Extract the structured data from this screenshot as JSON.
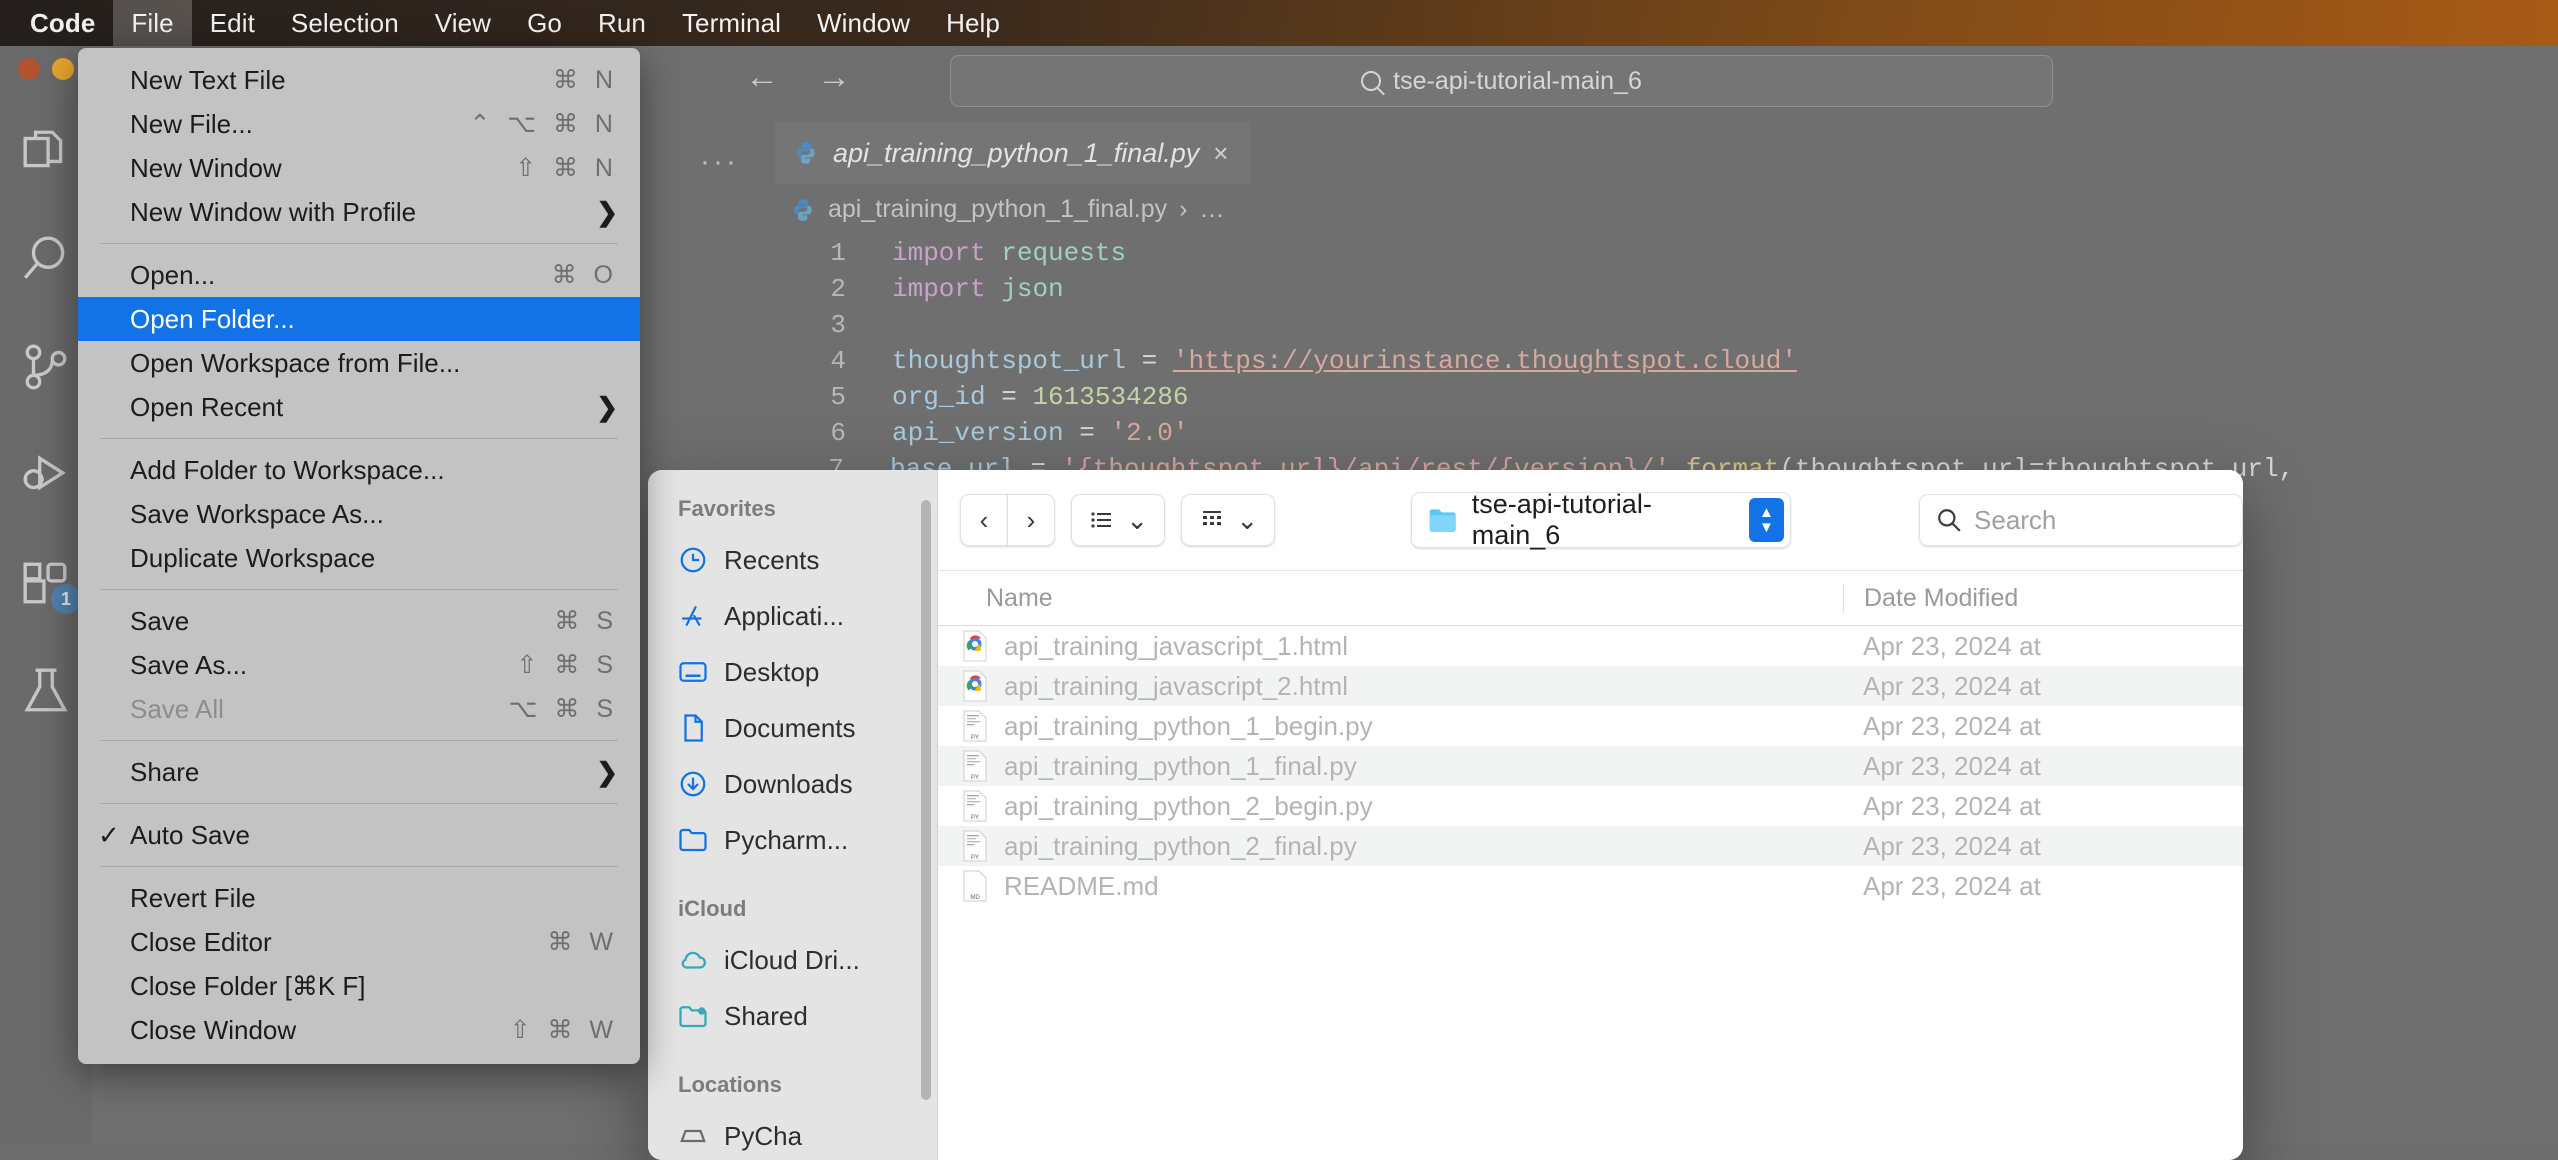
{
  "menubar": {
    "items": [
      {
        "label": "Code",
        "bold": true,
        "active": false
      },
      {
        "label": "File",
        "bold": false,
        "active": true
      },
      {
        "label": "Edit",
        "bold": false,
        "active": false
      },
      {
        "label": "Selection",
        "bold": false,
        "active": false
      },
      {
        "label": "View",
        "bold": false,
        "active": false
      },
      {
        "label": "Go",
        "bold": false,
        "active": false
      },
      {
        "label": "Run",
        "bold": false,
        "active": false
      },
      {
        "label": "Terminal",
        "bold": false,
        "active": false
      },
      {
        "label": "Window",
        "bold": false,
        "active": false
      },
      {
        "label": "Help",
        "bold": false,
        "active": false
      }
    ]
  },
  "file_menu": {
    "items": [
      {
        "label": "New Text File",
        "shortcut": "⌘ N",
        "type": "item"
      },
      {
        "label": "New File...",
        "shortcut": "⌃ ⌥ ⌘ N",
        "type": "item"
      },
      {
        "label": "New Window",
        "shortcut": "⇧ ⌘ N",
        "type": "item"
      },
      {
        "label": "New Window with Profile",
        "shortcut": "",
        "type": "submenu"
      },
      {
        "type": "separator"
      },
      {
        "label": "Open...",
        "shortcut": "⌘ O",
        "type": "item"
      },
      {
        "label": "Open Folder...",
        "shortcut": "",
        "type": "item",
        "selected": true
      },
      {
        "label": "Open Workspace from File...",
        "shortcut": "",
        "type": "item"
      },
      {
        "label": "Open Recent",
        "shortcut": "",
        "type": "submenu"
      },
      {
        "type": "separator"
      },
      {
        "label": "Add Folder to Workspace...",
        "shortcut": "",
        "type": "item"
      },
      {
        "label": "Save Workspace As...",
        "shortcut": "",
        "type": "item"
      },
      {
        "label": "Duplicate Workspace",
        "shortcut": "",
        "type": "item"
      },
      {
        "type": "separator"
      },
      {
        "label": "Save",
        "shortcut": "⌘ S",
        "type": "item"
      },
      {
        "label": "Save As...",
        "shortcut": "⇧ ⌘ S",
        "type": "item"
      },
      {
        "label": "Save All",
        "shortcut": "⌥ ⌘ S",
        "type": "item",
        "disabled": true
      },
      {
        "type": "separator"
      },
      {
        "label": "Share",
        "shortcut": "",
        "type": "submenu"
      },
      {
        "type": "separator"
      },
      {
        "label": "Auto Save",
        "shortcut": "",
        "type": "item",
        "checked": true
      },
      {
        "type": "separator"
      },
      {
        "label": "Revert File",
        "shortcut": "",
        "type": "item"
      },
      {
        "label": "Close Editor",
        "shortcut": "⌘ W",
        "type": "item"
      },
      {
        "label": "Close Folder [⌘K F]",
        "shortcut": "",
        "type": "item"
      },
      {
        "label": "Close Window",
        "shortcut": "⇧ ⌘ W",
        "type": "item"
      }
    ]
  },
  "editor": {
    "omnibox_text": "tse-api-tutorial-main_6",
    "tab_name": "api_training_python_1_final.py",
    "tab_close": "×",
    "breadcrumb_file": "api_training_python_1_final.py",
    "breadcrumb_sep": "›",
    "breadcrumb_tail": "…",
    "dots": "···",
    "nav_back": "←",
    "nav_fwd": "→",
    "lines": [
      {
        "no": "1",
        "tokens": [
          {
            "t": "import",
            "c": "kw"
          },
          {
            "t": " ",
            "c": "op"
          },
          {
            "t": "requests",
            "c": "id"
          }
        ]
      },
      {
        "no": "2",
        "tokens": [
          {
            "t": "import",
            "c": "kw"
          },
          {
            "t": " ",
            "c": "op"
          },
          {
            "t": "json",
            "c": "id"
          }
        ]
      },
      {
        "no": "3",
        "tokens": []
      },
      {
        "no": "4",
        "tokens": [
          {
            "t": "thoughtspot_url",
            "c": "var"
          },
          {
            "t": " = ",
            "c": "op"
          },
          {
            "t": "'https://yourinstance.thoughtspot.cloud'",
            "c": "str ulink"
          }
        ]
      },
      {
        "no": "5",
        "tokens": [
          {
            "t": "org_id",
            "c": "var"
          },
          {
            "t": " = ",
            "c": "op"
          },
          {
            "t": "1613534286",
            "c": "num"
          }
        ]
      },
      {
        "no": "6",
        "tokens": [
          {
            "t": "api_version",
            "c": "var"
          },
          {
            "t": " = ",
            "c": "op"
          },
          {
            "t": "'2.0'",
            "c": "str"
          }
        ]
      },
      {
        "no": "7",
        "tokens": [
          {
            "t": "base_url",
            "c": "var"
          },
          {
            "t": " = ",
            "c": "op"
          },
          {
            "t": "'{thoughtspot_url}/api/rest/{version}/'",
            "c": "str"
          },
          {
            "t": ".",
            "c": "op"
          },
          {
            "t": "format",
            "c": "fn"
          },
          {
            "t": "(thoughtspot_url=thoughtspot_url, version=api_version)",
            "c": "op"
          }
        ]
      }
    ]
  },
  "activity_bar": {
    "icons": [
      {
        "name": "explorer-icon",
        "badge": ""
      },
      {
        "name": "search-icon",
        "badge": ""
      },
      {
        "name": "source-control-icon",
        "badge": ""
      },
      {
        "name": "run-debug-icon",
        "badge": ""
      },
      {
        "name": "extensions-icon",
        "badge": "1"
      },
      {
        "name": "testing-icon",
        "badge": ""
      }
    ]
  },
  "finder": {
    "toolbar": {
      "back": "‹",
      "forward": "›",
      "list_view_chevron": "⌄",
      "icon_view_chevron": "⌄",
      "path_label": "tse-api-tutorial-main_6",
      "search_placeholder": "Search"
    },
    "sidebar": {
      "sections": [
        {
          "title": "Favorites",
          "items": [
            {
              "label": "Recents",
              "icon": "clock-icon"
            },
            {
              "label": "Applicati...",
              "icon": "applications-icon"
            },
            {
              "label": "Desktop",
              "icon": "desktop-icon"
            },
            {
              "label": "Documents",
              "icon": "document-icon"
            },
            {
              "label": "Downloads",
              "icon": "download-icon"
            },
            {
              "label": "Pycharm...",
              "icon": "folder-icon"
            }
          ]
        },
        {
          "title": "iCloud",
          "items": [
            {
              "label": "iCloud Dri...",
              "icon": "cloud-icon"
            },
            {
              "label": "Shared",
              "icon": "shared-folder-icon"
            }
          ]
        },
        {
          "title": "Locations",
          "items": [
            {
              "label": "PyCha",
              "icon": "disk-icon"
            }
          ]
        }
      ]
    },
    "columns": {
      "name": "Name",
      "date_modified": "Date Modified"
    },
    "files": [
      {
        "name": "api_training_javascript_1.html",
        "date": "Apr 23, 2024 at",
        "icon": "chrome-html-icon"
      },
      {
        "name": "api_training_javascript_2.html",
        "date": "Apr 23, 2024 at",
        "icon": "chrome-html-icon"
      },
      {
        "name": "api_training_python_1_begin.py",
        "date": "Apr 23, 2024 at",
        "icon": "python-file-icon"
      },
      {
        "name": "api_training_python_1_final.py",
        "date": "Apr 23, 2024 at",
        "icon": "python-file-icon"
      },
      {
        "name": "api_training_python_2_begin.py",
        "date": "Apr 23, 2024 at",
        "icon": "python-file-icon"
      },
      {
        "name": "api_training_python_2_final.py",
        "date": "Apr 23, 2024 at",
        "icon": "python-file-icon"
      },
      {
        "name": "README.md",
        "date": "Apr 23, 2024 at",
        "icon": "markdown-file-icon"
      }
    ]
  },
  "colors": {
    "accent_blue": "#1273e6",
    "menu_bg": "#c3c3c3",
    "finder_bg": "#ffffff",
    "sidebar_bg": "#e4e4e4"
  }
}
